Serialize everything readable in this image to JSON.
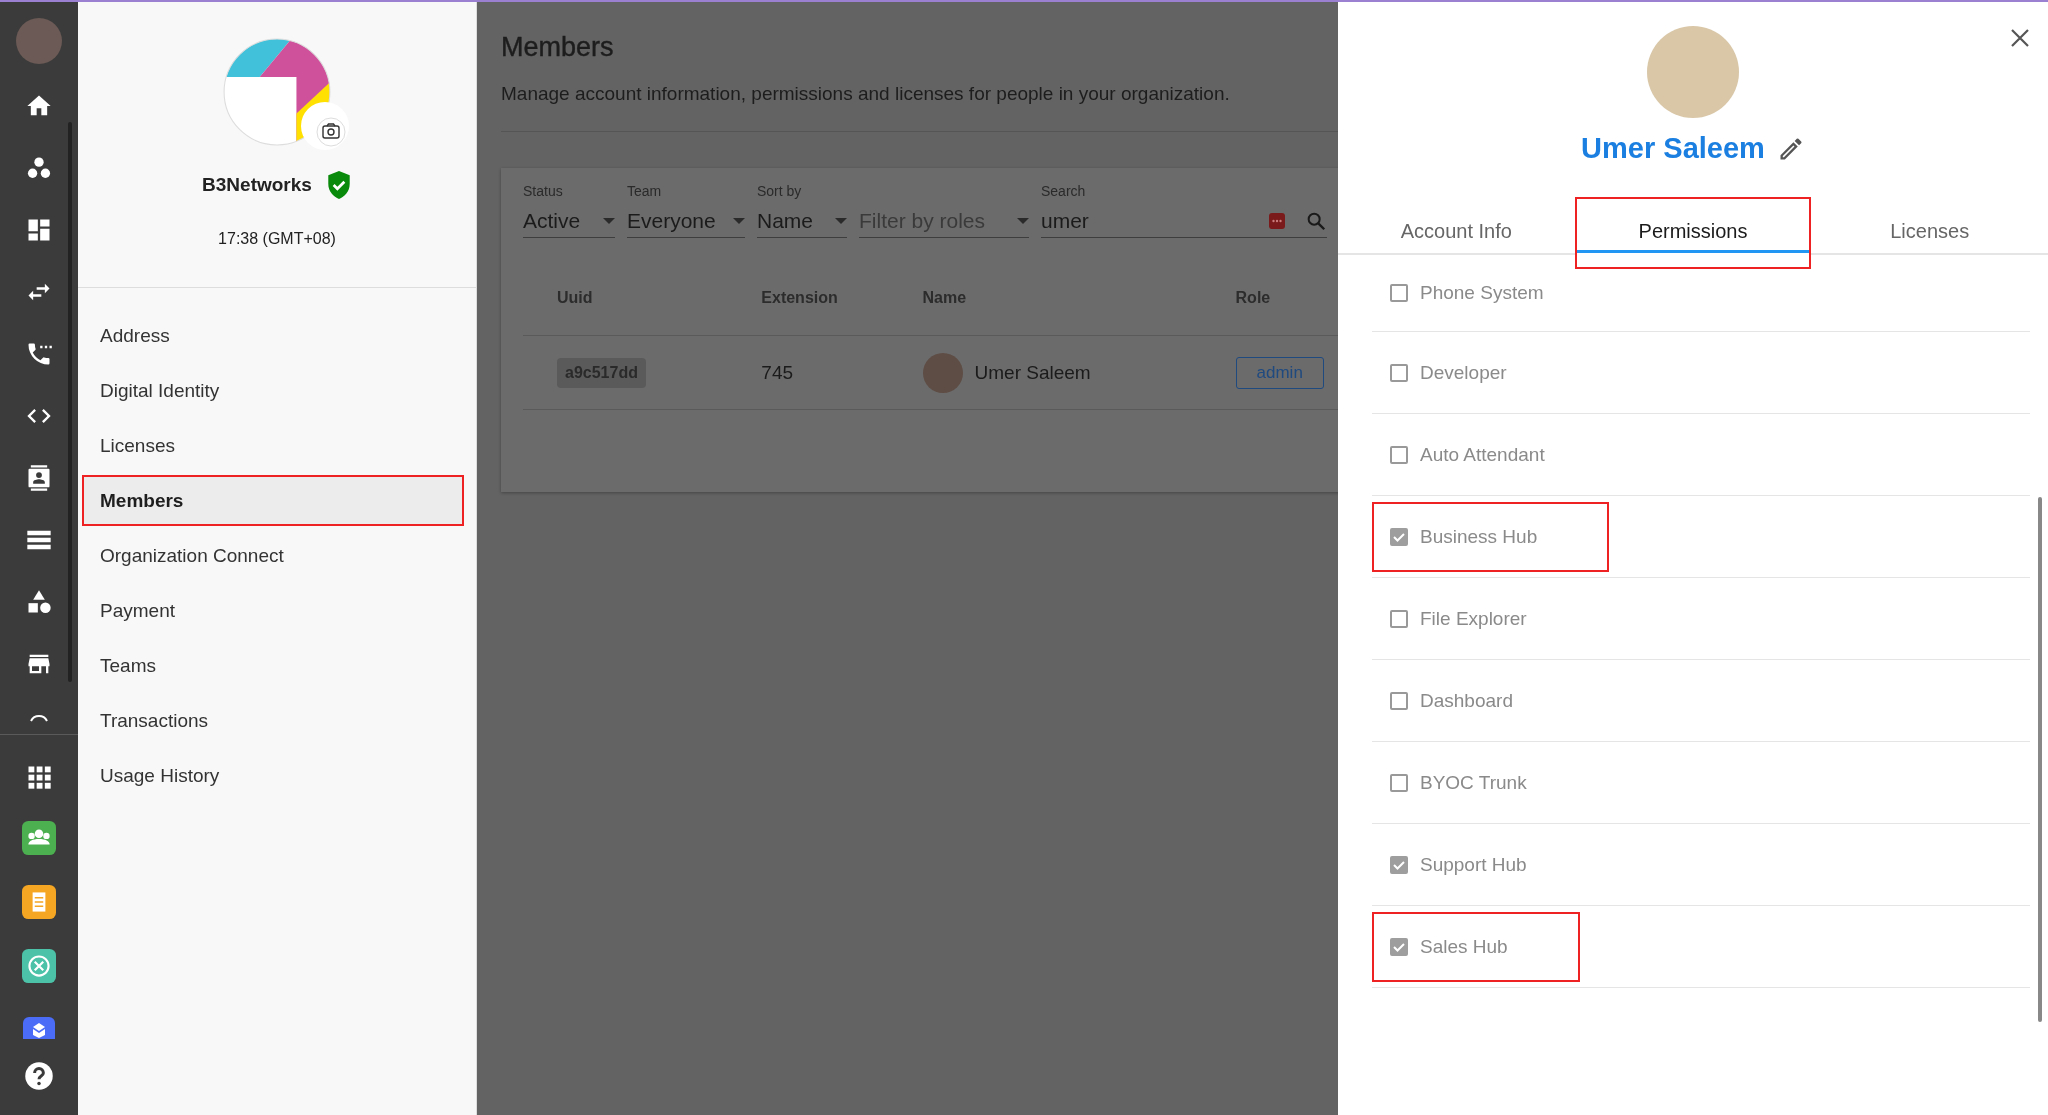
{
  "organization": {
    "name": "B3Networks",
    "verified": true,
    "time": "17:38 (GMT+08)"
  },
  "nav_items": [
    {
      "label": "Address",
      "selected": false,
      "highlighted": false
    },
    {
      "label": "Digital Identity",
      "selected": false,
      "highlighted": false
    },
    {
      "label": "Licenses",
      "selected": false,
      "highlighted": false
    },
    {
      "label": "Members",
      "selected": true,
      "highlighted": true
    },
    {
      "label": "Organization Connect",
      "selected": false,
      "highlighted": false
    },
    {
      "label": "Payment",
      "selected": false,
      "highlighted": false
    },
    {
      "label": "Teams",
      "selected": false,
      "highlighted": false
    },
    {
      "label": "Transactions",
      "selected": false,
      "highlighted": false
    },
    {
      "label": "Usage History",
      "selected": false,
      "highlighted": false
    }
  ],
  "page": {
    "title": "Members",
    "subtitle": "Manage account information, permissions and licenses for people in your organization."
  },
  "filters": [
    {
      "label": "Status",
      "value": "Active"
    },
    {
      "label": "Team",
      "value": "Everyone"
    },
    {
      "label": "Sort by",
      "value": "Name"
    },
    {
      "placeholder": "Filter by roles"
    }
  ],
  "search": {
    "label": "Search",
    "value": "umer"
  },
  "table": {
    "columns": [
      "Uuid",
      "Extension",
      "Name",
      "Role"
    ],
    "rows": [
      {
        "uuid": "a9c517dd",
        "extension": "745",
        "name": "Umer Saleem",
        "role": "admin"
      }
    ]
  },
  "panel": {
    "name": "Umer Saleem",
    "tabs": [
      {
        "label": "Account Info",
        "selected": false,
        "highlighted": false
      },
      {
        "label": "Permissions",
        "selected": true,
        "highlighted": true
      },
      {
        "label": "Licenses",
        "selected": false,
        "highlighted": false
      }
    ],
    "permissions": [
      {
        "label": "Phone System",
        "checked": false,
        "highlighted": false
      },
      {
        "label": "Developer",
        "checked": false,
        "highlighted": false
      },
      {
        "label": "Auto Attendant",
        "checked": false,
        "highlighted": false
      },
      {
        "label": "Business Hub",
        "checked": true,
        "highlighted": true
      },
      {
        "label": "File Explorer",
        "checked": false,
        "highlighted": false
      },
      {
        "label": "Dashboard",
        "checked": false,
        "highlighted": false
      },
      {
        "label": "BYOC Trunk",
        "checked": false,
        "highlighted": false
      },
      {
        "label": "Support Hub",
        "checked": true,
        "highlighted": false
      },
      {
        "label": "Sales Hub",
        "checked": true,
        "highlighted": true
      }
    ]
  }
}
